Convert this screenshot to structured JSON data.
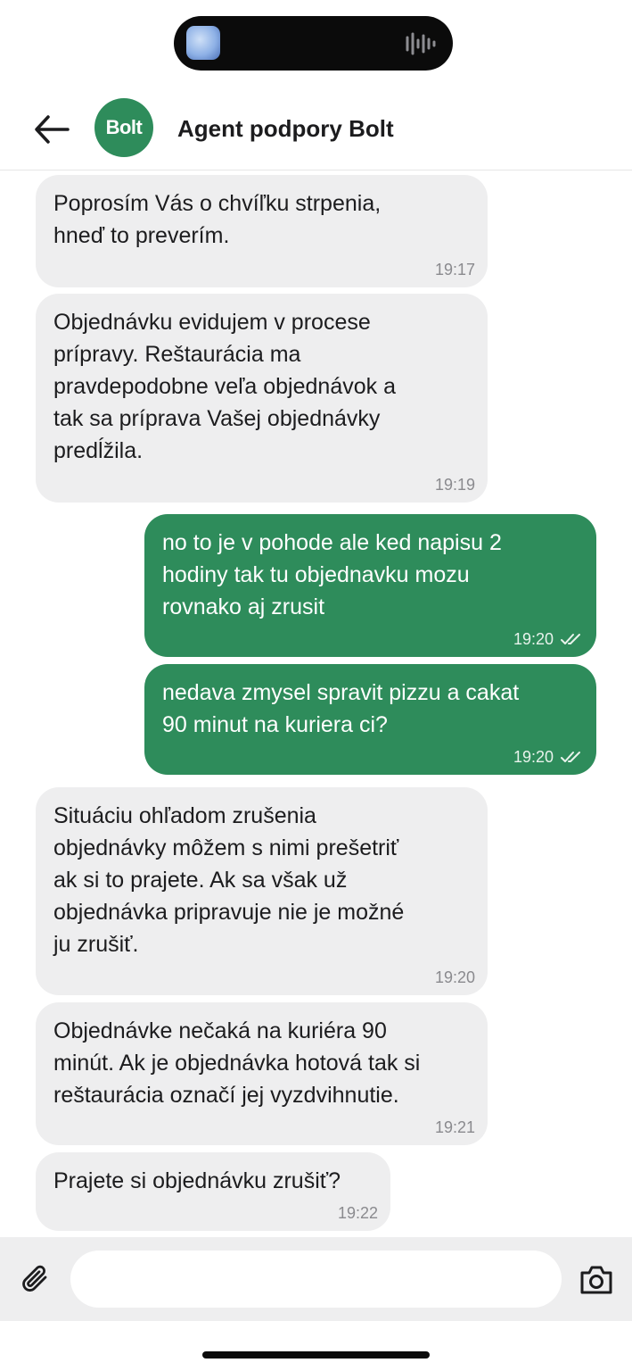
{
  "header": {
    "avatar_text": "Bolt",
    "title": "Agent podpory Bolt"
  },
  "messages": [
    {
      "from": "agent",
      "text": "Poprosím Vás o chvíľku strpenia,\nhneď to preverím.",
      "time": "19:17"
    },
    {
      "from": "agent",
      "text": "Objednávku evidujem v procese\nprípravy. Reštaurácia ma\npravdepodobne veľa objednávok a\ntak sa príprava Vašej objednávky\npredĺžila.",
      "time": "19:19"
    },
    {
      "from": "user",
      "text": "no to je v pohode ale ked napisu 2\nhodiny tak tu objednavku mozu\nrovnako aj zrusit",
      "time": "19:20",
      "status": "read"
    },
    {
      "from": "user",
      "text": "nedava zmysel spravit pizzu a cakat\n90 minut na kuriera ci?",
      "time": "19:20",
      "status": "read"
    },
    {
      "from": "agent",
      "text": "Situáciu ohľadom zrušenia\nobjednávky môžem s nimi prešetriť\nak si to prajete. Ak sa však už\nobjednávka pripravuje nie je možné\nju zrušiť.",
      "time": "19:20"
    },
    {
      "from": "agent",
      "text": "Objednávke nečaká na kuriéra 90\nminút. Ak je objednávka hotová tak si\nreštaurácia označí jej vyzdvihnutie.",
      "time": "19:21"
    },
    {
      "from": "agent",
      "text": "Prajete si objednávku zrušiť?",
      "time": "19:22"
    }
  ],
  "composer": {
    "value": "",
    "placeholder": ""
  },
  "colors": {
    "brand_green": "#2e8c5b",
    "incoming_bubble": "#eeeeef",
    "composer_bg": "#eeeeef"
  },
  "icons": {
    "back": "back-arrow-icon",
    "attach": "paperclip-icon",
    "camera": "camera-icon",
    "read_receipt": "double-check-icon"
  }
}
